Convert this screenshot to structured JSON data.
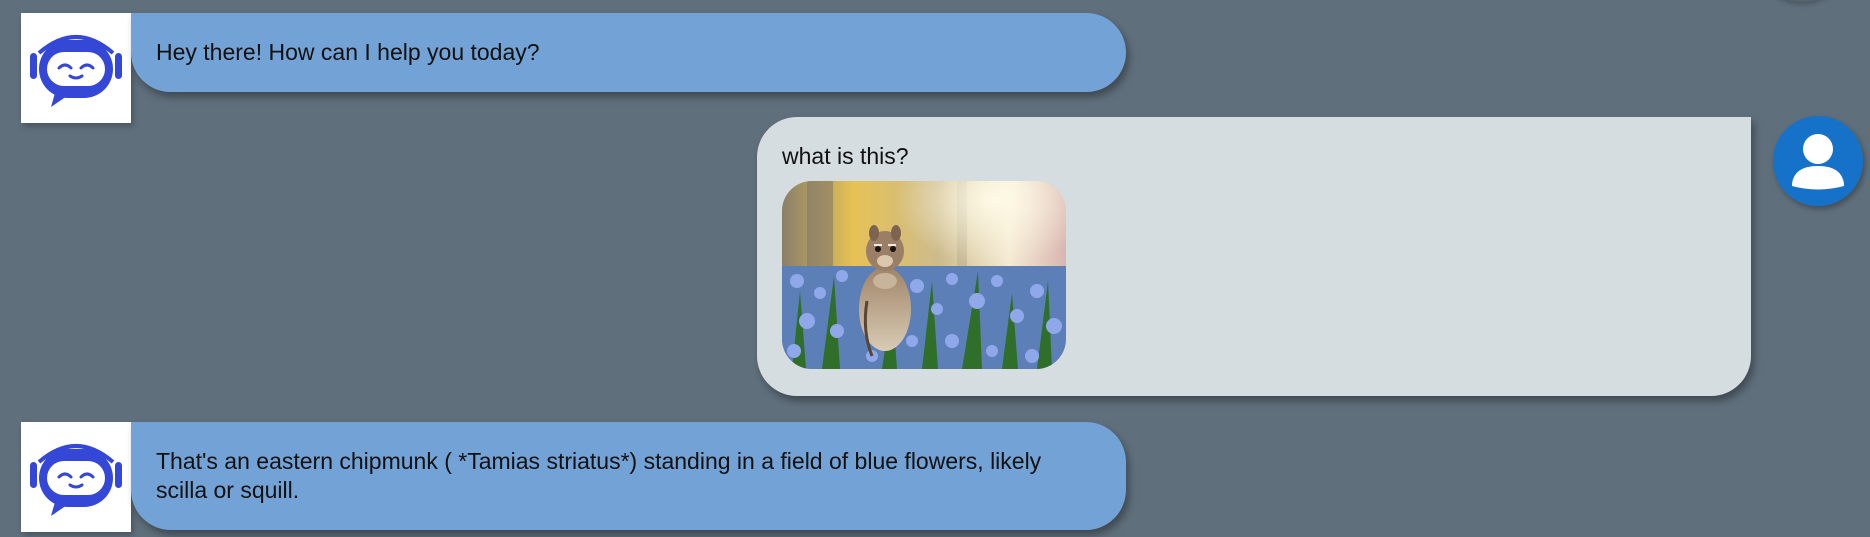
{
  "colors": {
    "background": "#5f6f7c",
    "bot_bubble": "#73a3d6",
    "user_bubble": "#d5dde1",
    "bot_icon": "#3447d6",
    "user_avatar": "#1672c9"
  },
  "messages": [
    {
      "role": "bot",
      "avatar_icon": "robot-icon",
      "text": "Hey there! How can I help you today?"
    },
    {
      "role": "user",
      "avatar_icon": "user-icon",
      "text": "what is this?",
      "image": "chipmunk-photo"
    },
    {
      "role": "bot",
      "avatar_icon": "robot-icon",
      "text": "That's an eastern chipmunk ( *Tamias striatus*) standing in a field of blue flowers, likely scilla or squill."
    }
  ]
}
